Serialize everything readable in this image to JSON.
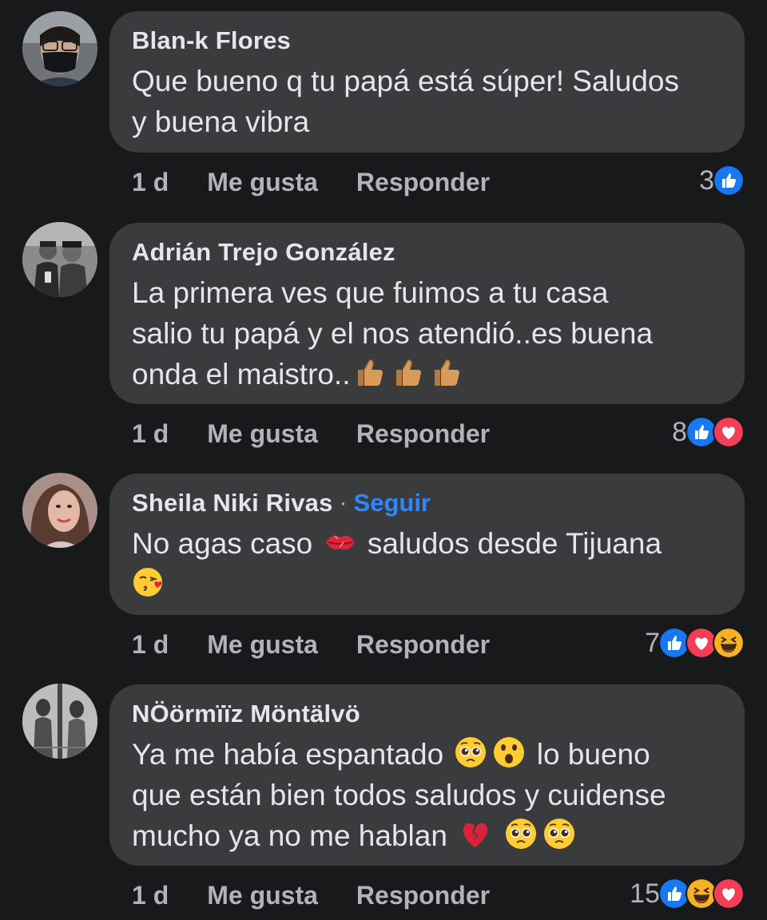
{
  "comments": [
    {
      "author": "Blan-k Flores",
      "follow": "",
      "lines": [
        "Que bueno q tu papá está súper! Saludos",
        "y buena vibra"
      ],
      "time": "1 d",
      "like": "Me gusta",
      "reply": "Responder",
      "reaction_count": "3",
      "reactions": [
        "like"
      ]
    },
    {
      "author": "Adrián Trejo González",
      "follow": "",
      "lines": [
        "La primera ves que fuimos a tu casa",
        "salio tu papá y el nos atendió..es buena",
        "onda el maistro.."
      ],
      "time": "1 d",
      "like": "Me gusta",
      "reply": "Responder",
      "reaction_count": "8",
      "reactions": [
        "like",
        "love"
      ],
      "emojis": [
        "thumbs-up-emoji",
        "thumbs-up-emoji",
        "thumbs-up-emoji"
      ]
    },
    {
      "author": "Sheila Niki Rivas",
      "follow": "Seguir",
      "lines": [
        "No agas caso",
        "saludos desde Tijuana"
      ],
      "time": "1 d",
      "like": "Me gusta",
      "reply": "Responder",
      "reaction_count": "7",
      "reactions": [
        "like",
        "love",
        "haha"
      ]
    },
    {
      "author": "NÖörmïïz Möntälvö",
      "follow": "",
      "lines": [
        "Ya me había espantado",
        "lo bueno",
        "que están bien todos saludos y cuidense",
        "mucho ya no me hablan"
      ],
      "time": "1 d",
      "like": "Me gusta",
      "reply": "Responder",
      "reaction_count": "15",
      "reactions": [
        "like",
        "haha",
        "love"
      ]
    }
  ],
  "colors": {
    "background": "#18191a",
    "bubble": "#3a3b3c",
    "text": "#e4e6eb",
    "muted": "#b0b3b8",
    "follow": "#2d88ff",
    "like": "#1877f2",
    "love": "#f33e58",
    "haha": "#f7b125"
  }
}
